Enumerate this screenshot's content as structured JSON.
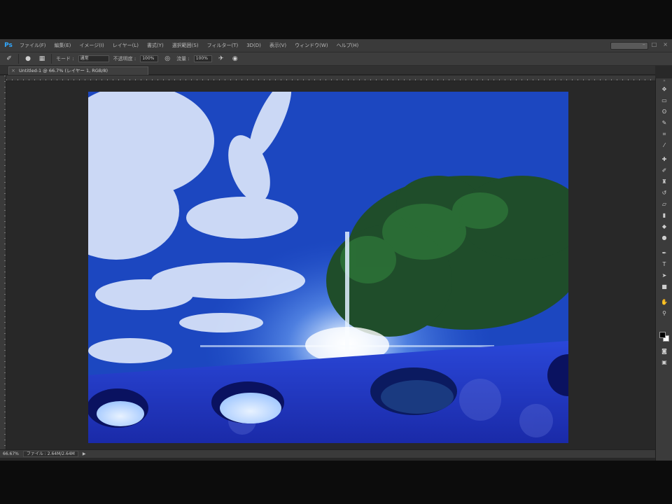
{
  "app": {
    "logo": "Ps",
    "menu": [
      "ファイル(F)",
      "編集(E)",
      "イメージ(I)",
      "レイヤー(L)",
      "書式(Y)",
      "選択範囲(S)",
      "フィルター(T)",
      "3D(D)",
      "表示(V)",
      "ウィンドウ(W)",
      "ヘルプ(H)"
    ],
    "window_controls": [
      "–",
      "□",
      "×"
    ]
  },
  "options": {
    "tool_icon": "brush-icon",
    "mode_label": "モード :",
    "mode_value": "通常",
    "opacity_label": "不透明度 :",
    "opacity_value": "100%",
    "flow_label": "流量 :",
    "flow_value": "100%"
  },
  "document": {
    "tab_title": "Untitled-1 @ 66.7% (レイヤー 1, RGB/8)",
    "close_glyph": "×"
  },
  "status": {
    "zoom": "66.67%",
    "doc_info": "ファイル : 2.64M/2.64M",
    "arrow": "▶"
  },
  "tools": [
    {
      "name": "move-tool-icon",
      "glyph": "✥"
    },
    {
      "name": "marquee-tool-icon",
      "glyph": "▭"
    },
    {
      "name": "lasso-tool-icon",
      "glyph": "ʘ"
    },
    {
      "name": "quick-select-tool-icon",
      "glyph": "✎"
    },
    {
      "name": "crop-tool-icon",
      "glyph": "⌗"
    },
    {
      "name": "eyedropper-tool-icon",
      "glyph": "⁄"
    },
    {
      "name": "healing-brush-tool-icon",
      "glyph": "✚"
    },
    {
      "name": "brush-tool-icon",
      "glyph": "✐"
    },
    {
      "name": "clone-stamp-tool-icon",
      "glyph": "♜"
    },
    {
      "name": "history-brush-tool-icon",
      "glyph": "↺"
    },
    {
      "name": "eraser-tool-icon",
      "glyph": "▱"
    },
    {
      "name": "gradient-tool-icon",
      "glyph": "▮"
    },
    {
      "name": "blur-tool-icon",
      "glyph": "◆"
    },
    {
      "name": "dodge-tool-icon",
      "glyph": "●"
    },
    {
      "name": "pen-tool-icon",
      "glyph": "✒"
    },
    {
      "name": "type-tool-icon",
      "glyph": "T"
    },
    {
      "name": "path-select-tool-icon",
      "glyph": "➤"
    },
    {
      "name": "shape-tool-icon",
      "glyph": "■"
    },
    {
      "name": "hand-tool-icon",
      "glyph": "✋"
    },
    {
      "name": "zoom-tool-icon",
      "glyph": "⚲"
    }
  ],
  "colors": {
    "foreground": "#000000",
    "background": "#ffffff"
  }
}
